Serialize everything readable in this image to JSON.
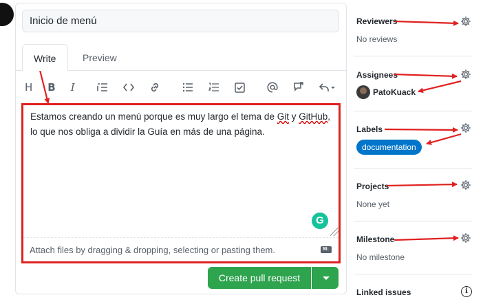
{
  "title_input": {
    "value": "Inicio de menú"
  },
  "tabs": [
    {
      "label": "Write"
    },
    {
      "label": "Preview"
    }
  ],
  "toolbar": {
    "icons": [
      "heading-icon",
      "bold-icon",
      "italic-icon",
      "quote-icon",
      "code-icon",
      "link-icon",
      "bulleted-list-icon",
      "numbered-list-icon",
      "task-list-icon",
      "mention-icon",
      "cross-reference-icon",
      "saved-reply-icon"
    ]
  },
  "editor": {
    "text_part1": "Estamos creando un menú porque es muy  largo el tema de ",
    "text_git": "Git",
    "text_part2": " y ",
    "text_github": "GitHub",
    "text_part3": ", lo que nos obliga a dividir la Guía en más de una página.",
    "attach_hint": "Attach files by dragging & dropping, selecting or pasting them.",
    "markdown_badge": "M↓"
  },
  "actions": {
    "create_label": "Create pull request"
  },
  "sidebar": {
    "reviewers": {
      "title": "Reviewers",
      "value": "No reviews"
    },
    "assignees": {
      "title": "Assignees",
      "user": "PatoKuack"
    },
    "labels": {
      "title": "Labels",
      "label": "documentation"
    },
    "projects": {
      "title": "Projects",
      "value": "None yet"
    },
    "milestone": {
      "title": "Milestone",
      "value": "No milestone"
    },
    "linked_issues": {
      "title": "Linked issues"
    }
  },
  "colors": {
    "annotation": "#e02020",
    "primary_button": "#2ea44f",
    "label_documentation": "#0075ca",
    "grammarly": "#15c39a"
  }
}
